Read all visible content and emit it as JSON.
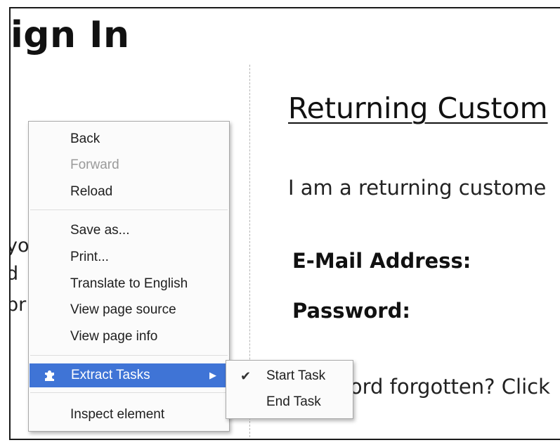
{
  "page": {
    "title": "Sign In",
    "left_fragments": [
      "yo",
      "d",
      "pr"
    ]
  },
  "returning": {
    "title": "Returning Custom",
    "intro": "I am a returning custome",
    "email_label": "E-Mail Address:",
    "password_label": "Password:",
    "forgot_text": "Password forgotten? Click"
  },
  "context_menu": {
    "back": "Back",
    "forward": "Forward",
    "reload": "Reload",
    "save_as": "Save as...",
    "print": "Print...",
    "translate": "Translate to English",
    "view_source": "View page source",
    "view_info": "View page info",
    "extract_tasks": "Extract Tasks",
    "inspect": "Inspect element",
    "icons": {
      "extension": "puzzle-icon",
      "submenu": "submenu-arrow-icon"
    },
    "highlight_color": "#3f74d6"
  },
  "submenu": {
    "start_task": "Start Task",
    "end_task": "End Task",
    "checked_icon": "checkmark-icon"
  }
}
